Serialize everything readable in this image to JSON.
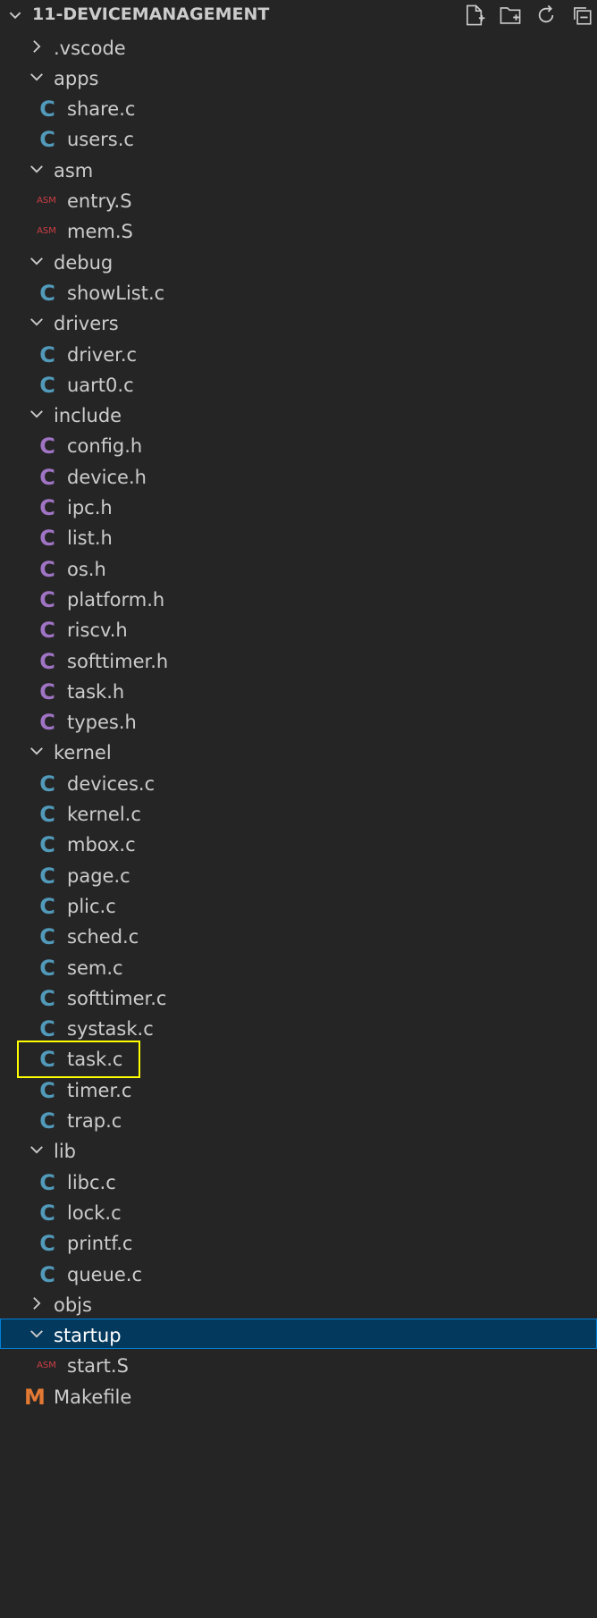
{
  "explorer": {
    "title": "11-DEVICEMANAGEMENT",
    "actions": [
      {
        "name": "new-file-icon"
      },
      {
        "name": "new-folder-icon"
      },
      {
        "name": "refresh-icon"
      },
      {
        "name": "collapse-all-icon"
      }
    ],
    "highlighted_item": "task.c",
    "selected_item": "startup",
    "colors": {
      "background": "#252526",
      "c_icon": "#519aba",
      "h_icon": "#a074c4",
      "asm_icon": "#cc3e44",
      "makefile_icon": "#e37933",
      "selection": "#04395e",
      "highlight_box": "#ffff00"
    },
    "tree": [
      {
        "label": ".vscode",
        "kind": "folder",
        "expanded": false,
        "depth": 0
      },
      {
        "label": "apps",
        "kind": "folder",
        "expanded": true,
        "depth": 0
      },
      {
        "label": "share.c",
        "kind": "c",
        "depth": 1
      },
      {
        "label": "users.c",
        "kind": "c",
        "depth": 1
      },
      {
        "label": "asm",
        "kind": "folder",
        "expanded": true,
        "depth": 0
      },
      {
        "label": "entry.S",
        "kind": "asm",
        "depth": 1
      },
      {
        "label": "mem.S",
        "kind": "asm",
        "depth": 1
      },
      {
        "label": "debug",
        "kind": "folder",
        "expanded": true,
        "depth": 0
      },
      {
        "label": "showList.c",
        "kind": "c",
        "depth": 1
      },
      {
        "label": "drivers",
        "kind": "folder",
        "expanded": true,
        "depth": 0
      },
      {
        "label": "driver.c",
        "kind": "c",
        "depth": 1
      },
      {
        "label": "uart0.c",
        "kind": "c",
        "depth": 1
      },
      {
        "label": "include",
        "kind": "folder",
        "expanded": true,
        "depth": 0
      },
      {
        "label": "config.h",
        "kind": "h",
        "depth": 1
      },
      {
        "label": "device.h",
        "kind": "h",
        "depth": 1
      },
      {
        "label": "ipc.h",
        "kind": "h",
        "depth": 1
      },
      {
        "label": "list.h",
        "kind": "h",
        "depth": 1
      },
      {
        "label": "os.h",
        "kind": "h",
        "depth": 1
      },
      {
        "label": "platform.h",
        "kind": "h",
        "depth": 1
      },
      {
        "label": "riscv.h",
        "kind": "h",
        "depth": 1
      },
      {
        "label": "softtimer.h",
        "kind": "h",
        "depth": 1
      },
      {
        "label": "task.h",
        "kind": "h",
        "depth": 1
      },
      {
        "label": "types.h",
        "kind": "h",
        "depth": 1
      },
      {
        "label": "kernel",
        "kind": "folder",
        "expanded": true,
        "depth": 0
      },
      {
        "label": "devices.c",
        "kind": "c",
        "depth": 1
      },
      {
        "label": "kernel.c",
        "kind": "c",
        "depth": 1
      },
      {
        "label": "mbox.c",
        "kind": "c",
        "depth": 1
      },
      {
        "label": "page.c",
        "kind": "c",
        "depth": 1
      },
      {
        "label": "plic.c",
        "kind": "c",
        "depth": 1
      },
      {
        "label": "sched.c",
        "kind": "c",
        "depth": 1
      },
      {
        "label": "sem.c",
        "kind": "c",
        "depth": 1
      },
      {
        "label": "softtimer.c",
        "kind": "c",
        "depth": 1
      },
      {
        "label": "systask.c",
        "kind": "c",
        "depth": 1
      },
      {
        "label": "task.c",
        "kind": "c",
        "depth": 1
      },
      {
        "label": "timer.c",
        "kind": "c",
        "depth": 1
      },
      {
        "label": "trap.c",
        "kind": "c",
        "depth": 1
      },
      {
        "label": "lib",
        "kind": "folder",
        "expanded": true,
        "depth": 0
      },
      {
        "label": "libc.c",
        "kind": "c",
        "depth": 1
      },
      {
        "label": "lock.c",
        "kind": "c",
        "depth": 1
      },
      {
        "label": "printf.c",
        "kind": "c",
        "depth": 1
      },
      {
        "label": "queue.c",
        "kind": "c",
        "depth": 1
      },
      {
        "label": "objs",
        "kind": "folder",
        "expanded": false,
        "depth": 0
      },
      {
        "label": "startup",
        "kind": "folder",
        "expanded": true,
        "depth": 0
      },
      {
        "label": "start.S",
        "kind": "asm",
        "depth": 1
      },
      {
        "label": "Makefile",
        "kind": "make",
        "depth": 0
      }
    ]
  }
}
